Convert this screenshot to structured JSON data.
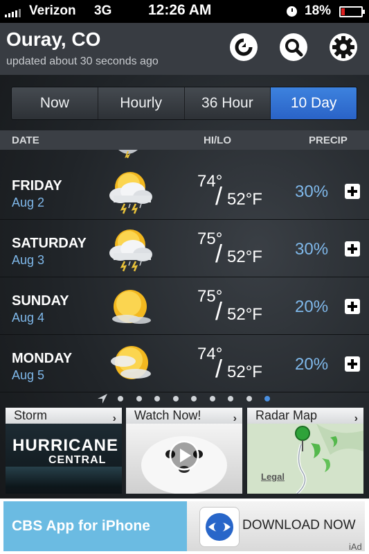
{
  "status_bar": {
    "carrier": "Verizon",
    "network": "3G",
    "time": "12:26 AM",
    "battery_percent": "18%",
    "battery_level": 0.18
  },
  "header": {
    "location": "Ouray, CO",
    "updated": "updated about 30 seconds ago",
    "buttons": [
      "refresh-icon",
      "search-icon",
      "gear-icon"
    ]
  },
  "tabs": [
    {
      "label": "Now",
      "active": false
    },
    {
      "label": "Hourly",
      "active": false
    },
    {
      "label": "36 Hour",
      "active": false
    },
    {
      "label": "10 Day",
      "active": true
    }
  ],
  "columns": {
    "date": "DATE",
    "hilo": "HI/LO",
    "precip": "PRECIP"
  },
  "forecast": [
    {
      "day": "FRIDAY",
      "date": "Aug 2",
      "hi": "74°",
      "lo": "52°F",
      "precip": "30%",
      "icon": "thunderstorm-icon"
    },
    {
      "day": "SATURDAY",
      "date": "Aug 3",
      "hi": "75°",
      "lo": "52°F",
      "precip": "30%",
      "icon": "thunderstorm-icon"
    },
    {
      "day": "SUNDAY",
      "date": "Aug 4",
      "hi": "75°",
      "lo": "52°F",
      "precip": "20%",
      "icon": "sunny-icon"
    },
    {
      "day": "MONDAY",
      "date": "Aug 5",
      "hi": "74°",
      "lo": "52°F",
      "precip": "20%",
      "icon": "partly-cloudy-icon"
    }
  ],
  "pager": {
    "pages": 9,
    "active_index": 8
  },
  "cards": [
    {
      "title": "Storm",
      "body_text": "HURRICANE",
      "body_sub": "CENTRAL"
    },
    {
      "title": "Watch Now!"
    },
    {
      "title": "Radar Map",
      "legal": "Legal"
    }
  ],
  "ad": {
    "title": "CBS App for iPhone",
    "cta": "DOWNLOAD NOW",
    "badge": "iAd"
  },
  "colors": {
    "accent": "#3577d6",
    "date_text": "#7fb8ea",
    "header_bg": "#383c42",
    "ad_blue": "#6bbbe2"
  }
}
